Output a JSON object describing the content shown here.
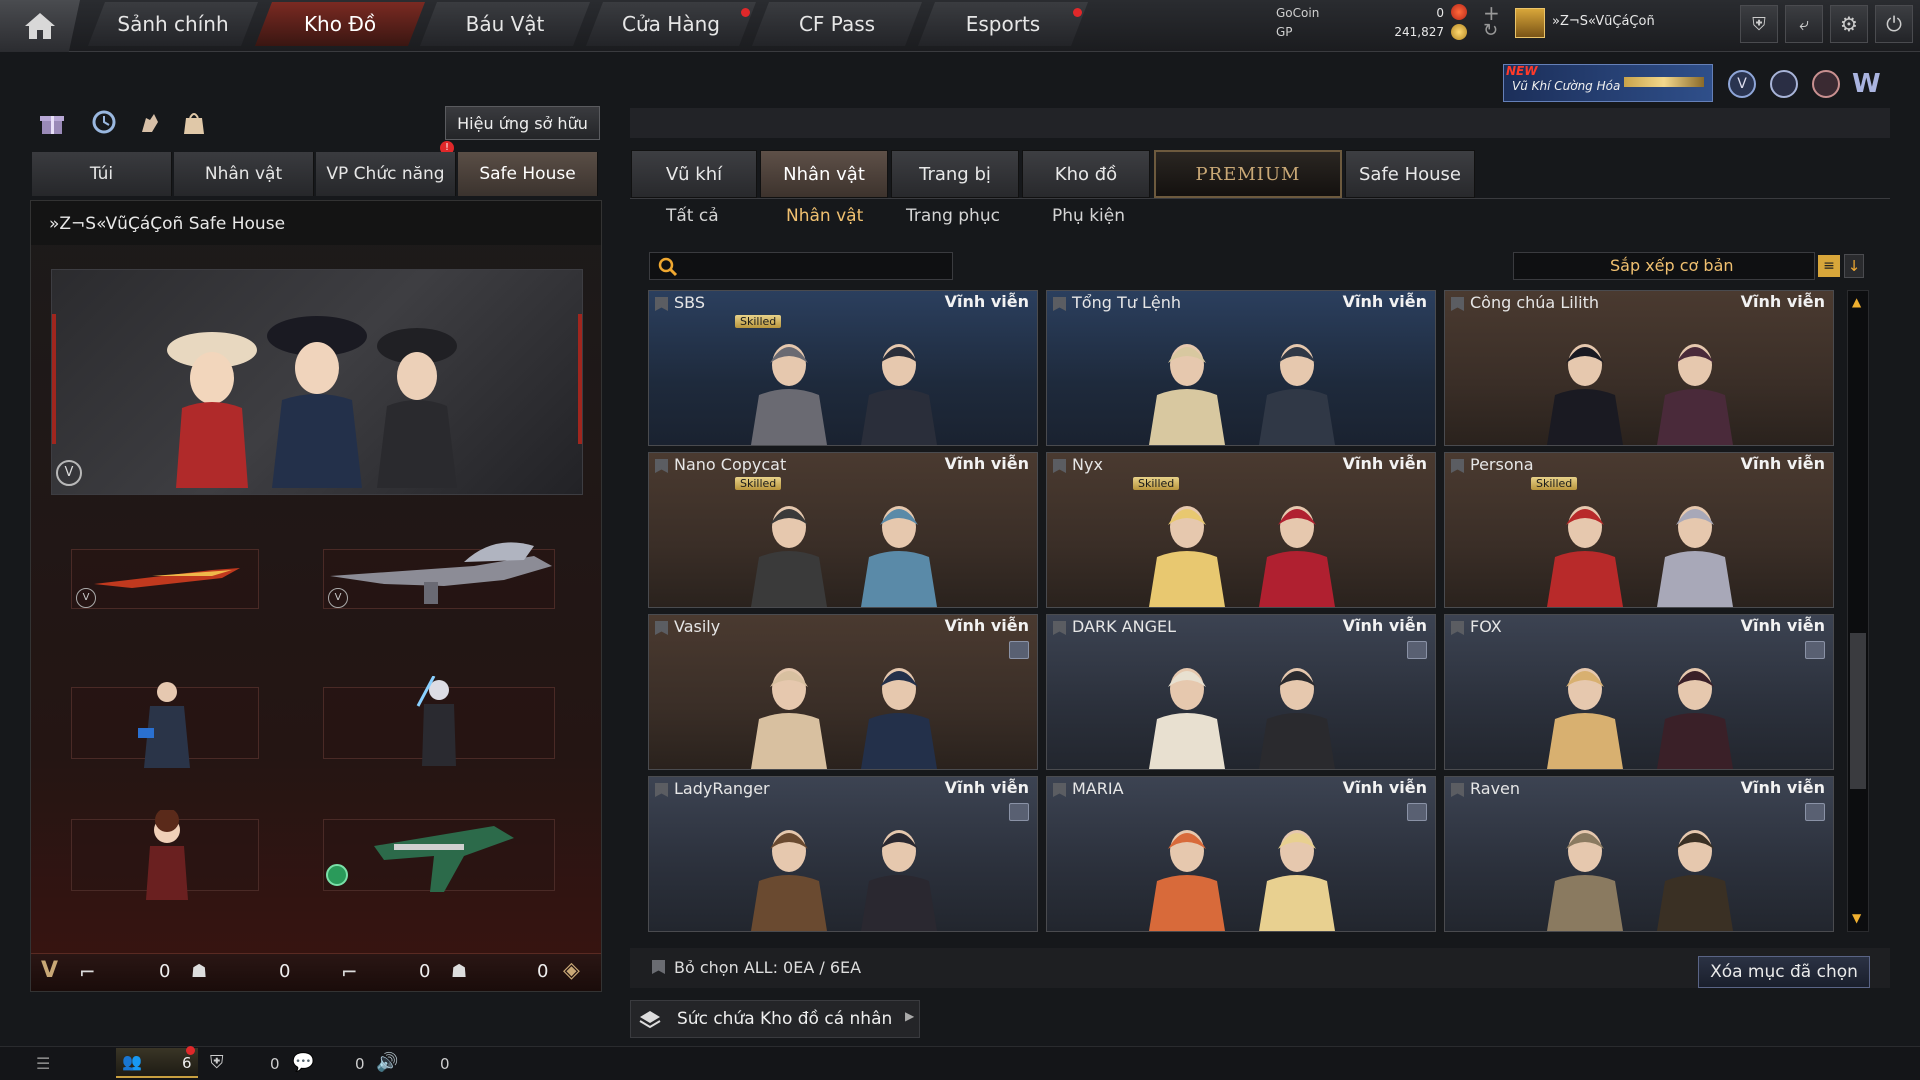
{
  "topbar": {
    "nav": [
      {
        "label": "Sảnh chính",
        "badge": false
      },
      {
        "label": "Kho Đồ",
        "badge": false,
        "active": true
      },
      {
        "label": "Báu Vật",
        "badge": false
      },
      {
        "label": "Cửa Hàng",
        "badge": true
      },
      {
        "label": "CF Pass",
        "badge": false
      },
      {
        "label": "Esports",
        "badge": true
      }
    ],
    "currency": {
      "gocoin_label": "GoCoin",
      "gocoin_value": "0",
      "gp_label": "GP",
      "gp_value": "241,827"
    },
    "player_name": "»Z¬S«VũÇáÇoñ",
    "promo": {
      "new": "NEW",
      "text": "Vũ Khí Cường Hóa"
    }
  },
  "left": {
    "effect_button": "Hiệu ứng sở hữu",
    "tabs": [
      "Túi",
      "Nhân vật",
      "VP Chức năng",
      "Safe House"
    ],
    "active_tab": 3,
    "panel_title": "»Z¬S«VũÇáÇoñ Safe House",
    "stats": {
      "a": "0",
      "b": "0",
      "c": "0",
      "d": "0"
    }
  },
  "right": {
    "tabs": [
      "Vũ khí",
      "Nhân vật",
      "Trang bị",
      "Kho đồ",
      "PREMIUM",
      "Safe House"
    ],
    "active_tab": 1,
    "subtabs": [
      "Tất cả",
      "Nhân vật",
      "Trang phục",
      "Phụ kiện"
    ],
    "active_subtab": 1,
    "search_placeholder": "",
    "sort_label": "Sắp xếp cơ bản",
    "items": [
      {
        "name": "SBS",
        "duration": "Vĩnh viễn",
        "skilled": "Skilled",
        "theme": "blue",
        "lock": false
      },
      {
        "name": "Tổng Tư Lệnh",
        "duration": "Vĩnh viễn",
        "skilled": "",
        "theme": "blue",
        "lock": false
      },
      {
        "name": "Công chúa Lilith",
        "duration": "Vĩnh viễn",
        "skilled": "",
        "theme": "brown",
        "lock": false
      },
      {
        "name": "Nano Copycat",
        "duration": "Vĩnh viễn",
        "skilled": "Skilled",
        "theme": "brown",
        "lock": false
      },
      {
        "name": "Nyx",
        "duration": "Vĩnh viễn",
        "skilled": "Skilled",
        "theme": "brown",
        "lock": false
      },
      {
        "name": "Persona",
        "duration": "Vĩnh viễn",
        "skilled": "Skilled",
        "theme": "brown",
        "lock": false
      },
      {
        "name": "Vasily",
        "duration": "Vĩnh viễn",
        "skilled": "",
        "theme": "brown",
        "lock": true
      },
      {
        "name": "DARK ANGEL",
        "duration": "Vĩnh viễn",
        "skilled": "",
        "theme": "slate",
        "lock": true
      },
      {
        "name": "FOX",
        "duration": "Vĩnh viễn",
        "skilled": "",
        "theme": "slate",
        "lock": true
      },
      {
        "name": "LadyRanger",
        "duration": "Vĩnh viễn",
        "skilled": "",
        "theme": "slate",
        "lock": true
      },
      {
        "name": "MARIA",
        "duration": "Vĩnh viễn",
        "skilled": "",
        "theme": "slate",
        "lock": true
      },
      {
        "name": "Raven",
        "duration": "Vĩnh viễn",
        "skilled": "",
        "theme": "slate",
        "lock": true
      }
    ],
    "deselect_label": "Bỏ chọn ALL: 0EA / 6EA",
    "delete_button": "Xóa mục đã chọn",
    "capacity_label": "Sức chứa Kho đồ cá nhân"
  },
  "bottombar": {
    "count1": "6",
    "count2": "0",
    "count3": "0",
    "count4": "0"
  },
  "colors": {
    "accent": "#e0282a",
    "gold": "#f0c070",
    "bg": "#16181b"
  }
}
